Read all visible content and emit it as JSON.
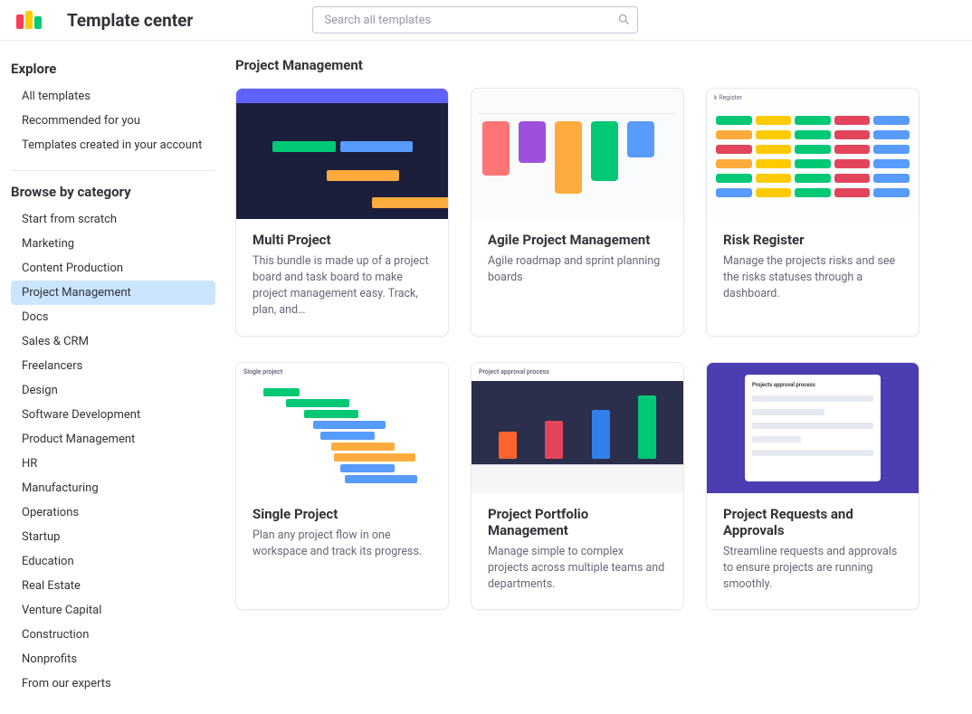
{
  "app_title": "Template center",
  "search": {
    "placeholder": "Search all templates"
  },
  "sidebar": {
    "explore_header": "Explore",
    "explore_items": [
      {
        "label": "All templates"
      },
      {
        "label": "Recommended for you"
      },
      {
        "label": "Templates created in your account"
      }
    ],
    "browse_header": "Browse by category",
    "category_items": [
      {
        "label": "Start from scratch",
        "active": false
      },
      {
        "label": "Marketing",
        "active": false
      },
      {
        "label": "Content Production",
        "active": false
      },
      {
        "label": "Project Management",
        "active": true
      },
      {
        "label": "Docs",
        "active": false
      },
      {
        "label": "Sales & CRM",
        "active": false
      },
      {
        "label": "Freelancers",
        "active": false
      },
      {
        "label": "Design",
        "active": false
      },
      {
        "label": "Software Development",
        "active": false
      },
      {
        "label": "Product Management",
        "active": false
      },
      {
        "label": "HR",
        "active": false
      },
      {
        "label": "Manufacturing",
        "active": false
      },
      {
        "label": "Operations",
        "active": false
      },
      {
        "label": "Startup",
        "active": false
      },
      {
        "label": "Education",
        "active": false
      },
      {
        "label": "Real Estate",
        "active": false
      },
      {
        "label": "Venture Capital",
        "active": false
      },
      {
        "label": "Construction",
        "active": false
      },
      {
        "label": "Nonprofits",
        "active": false
      },
      {
        "label": "From our experts",
        "active": false
      }
    ]
  },
  "main": {
    "title": "Project Management",
    "cards": [
      {
        "title": "Multi Project",
        "desc": "This bundle is made up of a project board and task board to make project management easy. Track, plan, and…",
        "thumb_label_small": "",
        "thumb": "gantt-dark"
      },
      {
        "title": "Agile Project Management",
        "desc": "Agile roadmap and sprint planning boards",
        "thumb_label_small": "",
        "thumb": "kanban"
      },
      {
        "title": "Risk Register",
        "desc": "Manage the projects risks and see the risks statuses through a dashboard.",
        "thumb_label_small": "k Register",
        "thumb": "status-grid"
      },
      {
        "title": "Single Project",
        "desc": "Plan any project flow in one workspace and track its progress.",
        "thumb_label_small": "Single project",
        "thumb": "gantt-light"
      },
      {
        "title": "Project Portfolio Management",
        "desc": "Manage simple to complex projects across multiple teams and departments.",
        "thumb_label_small": "Project approval process",
        "thumb": "bar-chart"
      },
      {
        "title": "Project Requests and Approvals",
        "desc": "Streamline requests and approvals to ensure projects are running smoothly.",
        "thumb_label_small": "Projects approval process",
        "thumb": "form"
      }
    ]
  }
}
